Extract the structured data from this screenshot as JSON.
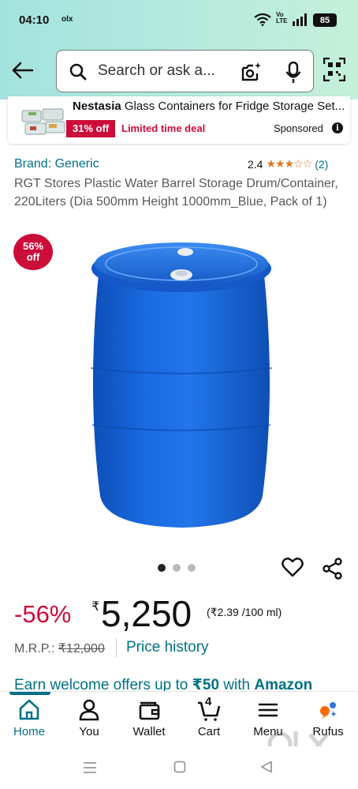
{
  "status_bar": {
    "time": "04:10",
    "network_app": "olx",
    "volte_top": "Vo",
    "volte_bottom": "LTE",
    "battery": "85"
  },
  "search": {
    "placeholder": "Search or ask a..."
  },
  "ad": {
    "brand": "Nestasia",
    "title": " Glass Containers for Fridge Storage Set...",
    "discount_badge": "31% off",
    "deal_label": "Limited time deal",
    "sponsored_label": "Sponsored",
    "info_icon": "i"
  },
  "product": {
    "brand": "Brand: Generic",
    "rating": "2.4",
    "stars_display": "★★★☆☆",
    "rating_value": 2.4,
    "review_count": "(2)",
    "title": "RGT Stores Plastic Water Barrel Storage Drum/Container, 220Liters (Dia 500mm Height 1000mm_Blue, Pack of 1)",
    "discount_bubble_top": "56%",
    "discount_bubble_bottom": "off",
    "image_count": 3,
    "image_active_index": 0
  },
  "pricing": {
    "discount": "-56%",
    "currency": "₹",
    "price": "5,250",
    "unit_price": "(₹2.39 /100 ml)",
    "mrp_label": "M.R.P.:",
    "mrp_value": "₹12,000",
    "price_history": "Price history"
  },
  "promo": {
    "prefix": "Earn welcome offers up to ",
    "amount": "₹50",
    "middle": " with ",
    "brand": "Amazon"
  },
  "bottom_nav": {
    "items": [
      {
        "label": "Home",
        "icon": "home-icon",
        "active": true
      },
      {
        "label": "You",
        "icon": "user-icon"
      },
      {
        "label": "Wallet",
        "icon": "wallet-icon"
      },
      {
        "label": "Cart",
        "icon": "cart-icon"
      },
      {
        "label": "Menu",
        "icon": "menu-icon"
      },
      {
        "label": "Rufus",
        "icon": "rufus-icon"
      }
    ],
    "cart_count": "4"
  },
  "colors": {
    "accent": "#007185",
    "deal_red": "#cc0c39",
    "star": "#de7921",
    "barrel_blue": "#1a66d6"
  }
}
